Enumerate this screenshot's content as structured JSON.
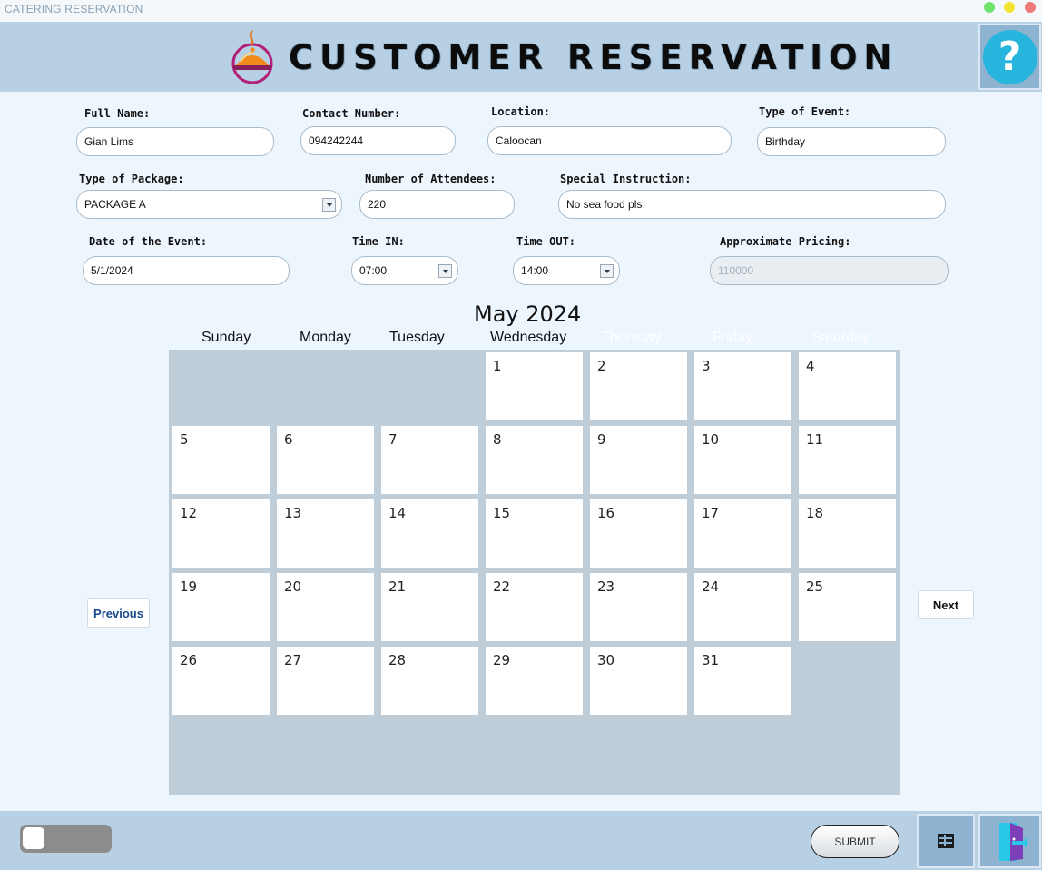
{
  "window": {
    "title": "CATERING RESERVATION"
  },
  "header": {
    "title": "CUSTOMER RESERVATION",
    "help_label": "?"
  },
  "form": {
    "full_name": {
      "label": "Full Name:",
      "value": "Gian Lims"
    },
    "contact_number": {
      "label": "Contact Number:",
      "value": "094242244"
    },
    "location": {
      "label": "Location:",
      "value": "Caloocan"
    },
    "event_type": {
      "label": "Type of Event:",
      "value": "Birthday"
    },
    "package_type": {
      "label": "Type of Package:",
      "value": "PACKAGE A"
    },
    "attendees": {
      "label": "Number of Attendees:",
      "value": "220"
    },
    "special_instruction": {
      "label": "Special Instruction:",
      "value": "No sea food pls"
    },
    "event_date": {
      "label": "Date of the Event:",
      "value": "5/1/2024"
    },
    "time_in": {
      "label": "Time IN:",
      "value": "07:00"
    },
    "time_out": {
      "label": "Time OUT:",
      "value": "14:00"
    },
    "pricing": {
      "label": "Approximate Pricing:",
      "value": "110000"
    }
  },
  "calendar": {
    "month_label": "May 2024",
    "day_names": [
      "Sunday",
      "Monday",
      "Tuesday",
      "Wednesday",
      "Thursday",
      "Friday",
      "Saturday"
    ],
    "first_weekday": 3,
    "days_in_month": 31,
    "prev_label": "Previous",
    "next_label": "Next"
  },
  "footer": {
    "submit_label": "SUBMIT"
  },
  "colors": {
    "header_bg": "#b8d0e3",
    "page_bg": "#eef6fd",
    "help_accent": "#27b5dd",
    "calendar_grid": "#bfcdd9"
  }
}
